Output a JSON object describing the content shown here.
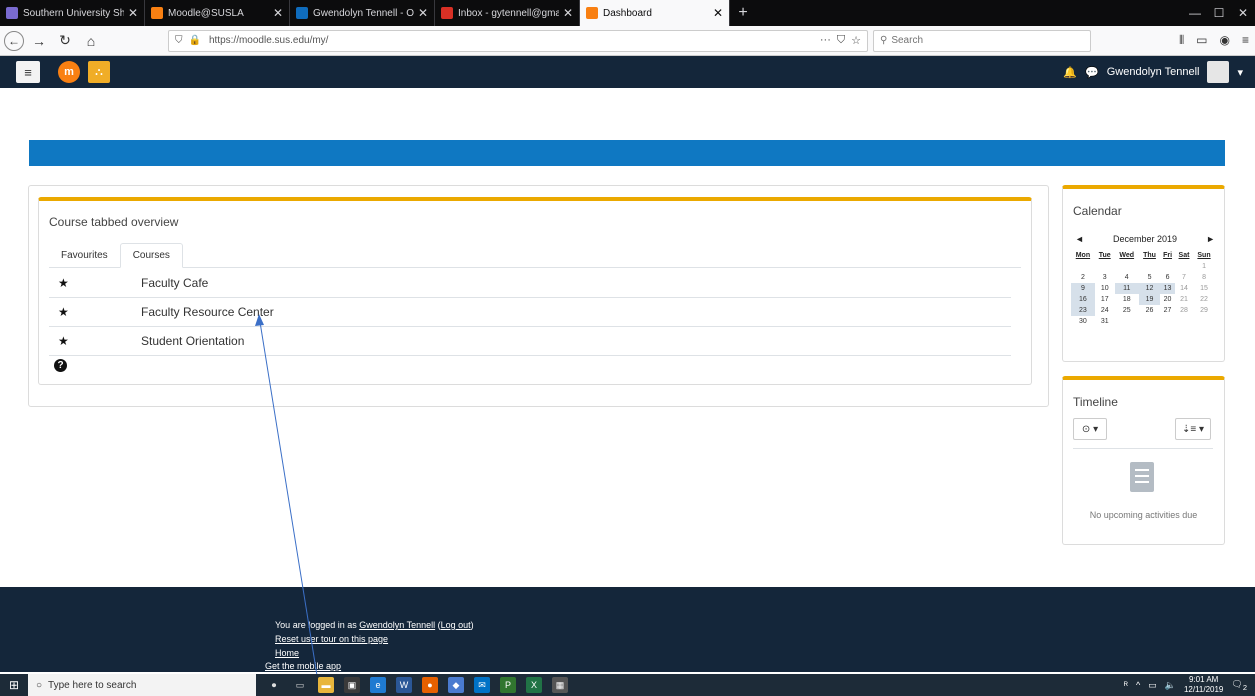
{
  "browser": {
    "tabs": [
      {
        "title": "Southern University Shreveport",
        "favicon_color": "#7a6bd0",
        "active": false
      },
      {
        "title": "Moodle@SUSLA",
        "favicon_color": "#f98012",
        "active": false
      },
      {
        "title": "Gwendolyn Tennell - Outlook",
        "favicon_color": "#0f6cbd",
        "active": false
      },
      {
        "title": "Inbox - gytennell@gmail.com",
        "favicon_color": "#d93025",
        "active": false
      },
      {
        "title": "Dashboard",
        "favicon_color": "#f98012",
        "active": true
      }
    ],
    "new_tab_glyph": "+",
    "url": "https://moodle.sus.edu/my/",
    "search_placeholder": "Search",
    "page_actions": "···",
    "window_controls": [
      "—",
      "☐",
      "✕"
    ]
  },
  "moodle_header": {
    "menu_glyph": "≡",
    "user_name": "Gwendolyn Tennell",
    "bell_glyph": "🔔",
    "chat_glyph": "💬",
    "caret": "▾"
  },
  "course_overview": {
    "title": "Course tabbed overview",
    "tabs": [
      {
        "label": "Favourites",
        "active": false
      },
      {
        "label": "Courses",
        "active": true
      }
    ],
    "courses": [
      {
        "name": "Faculty Cafe"
      },
      {
        "name": "Faculty Resource Center"
      },
      {
        "name": "Student Orientation"
      }
    ],
    "help_glyph": "?"
  },
  "calendar": {
    "title": "Calendar",
    "month": "December 2019",
    "prev": "◄",
    "next": "►",
    "weekdays": [
      "Mon",
      "Tue",
      "Wed",
      "Thu",
      "Fri",
      "Sat",
      "Sun"
    ],
    "weeks": [
      [
        "",
        "",
        "",
        "",
        "",
        "",
        "1"
      ],
      [
        "2",
        "3",
        "4",
        "5",
        "6",
        "7",
        "8"
      ],
      [
        "9",
        "10",
        "11",
        "12",
        "13",
        "14",
        "15"
      ],
      [
        "16",
        "17",
        "18",
        "19",
        "20",
        "21",
        "22"
      ],
      [
        "23",
        "24",
        "25",
        "26",
        "27",
        "28",
        "29"
      ],
      [
        "30",
        "31",
        "",
        "",
        "",
        "",
        ""
      ]
    ],
    "event_days": [
      "9",
      "11",
      "12",
      "13",
      "16",
      "19",
      "23"
    ]
  },
  "timeline": {
    "title": "Timeline",
    "filter_label": "⊙ ▾",
    "sort_label": "⇣≡ ▾",
    "empty_message": "No upcoming activities due"
  },
  "footer": {
    "logged_in_prefix": "You are logged in as ",
    "user_link": "Gwendolyn Tennell",
    "logout_link": "Log out",
    "reset_tour": "Reset user tour on this page",
    "home": "Home",
    "mobile_app": "Get the mobile app"
  },
  "taskbar": {
    "search_placeholder": "Type here to search",
    "time": "9:01 AM",
    "date": "12/11/2019",
    "notification_count": "2"
  }
}
